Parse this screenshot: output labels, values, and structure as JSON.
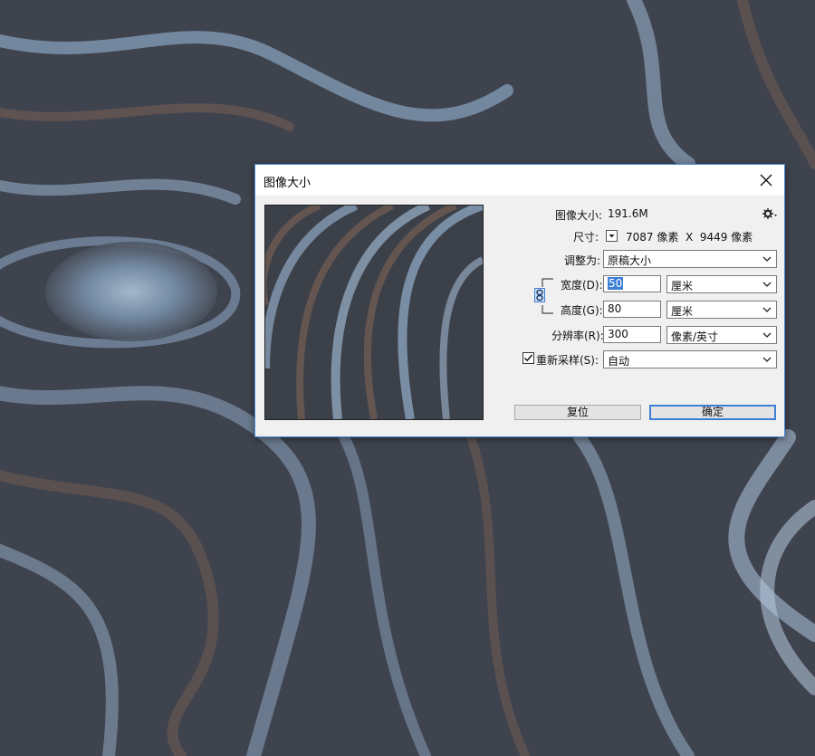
{
  "dialog": {
    "title": "图像大小",
    "image_size_label": "图像大小:",
    "image_size_value": "191.6M",
    "dimensions_label": "尺寸:",
    "dimensions_value": "7087 像素  X  9449 像素",
    "fit_to_label": "调整为:",
    "fit_to_value": "原稿大小",
    "width_label": "宽度(D):",
    "width_value": "50",
    "width_unit": "厘米",
    "height_label": "高度(G):",
    "height_value": "80",
    "height_unit": "厘米",
    "resolution_label": "分辨率(R):",
    "resolution_value": "300",
    "resolution_unit": "像素/英寸",
    "resample_label": "重新采样(S):",
    "resample_checked": true,
    "resample_value": "自动",
    "reset_button": "复位",
    "ok_button": "确定"
  },
  "colors": {
    "accent": "#3d7fd6",
    "dialog_bg": "#f0f0f0"
  },
  "icons": {
    "close": "close-icon",
    "settings": "gear-icon",
    "link": "chain-link-icon",
    "dropdown": "chevron-down-icon"
  }
}
